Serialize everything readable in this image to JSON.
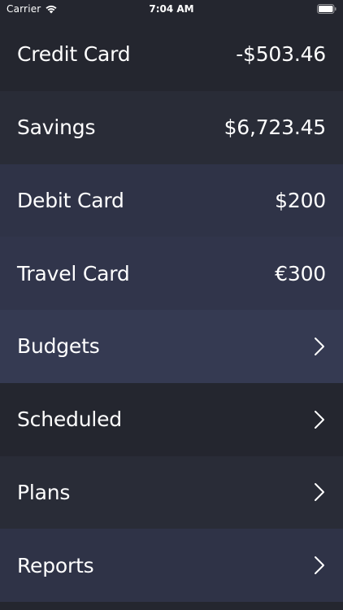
{
  "status_bar": {
    "carrier": "Carrier",
    "time": "7:04 AM",
    "wifi_icon": "wifi-icon",
    "battery_icon": "battery-icon"
  },
  "colors": {
    "row_dark_1": "#24262f",
    "row_dark_2": "#292c37",
    "row_blue_1": "#2f3347",
    "row_blue_2": "#31354b",
    "row_blue_3": "#353a52",
    "text": "#ffffff"
  },
  "accounts": [
    {
      "label": "Credit Card",
      "value": "-$503.46"
    },
    {
      "label": "Savings",
      "value": "$6,723.45"
    },
    {
      "label": "Debit Card",
      "value": "$200"
    },
    {
      "label": "Travel Card",
      "value": "€300"
    }
  ],
  "menu": [
    {
      "label": "Budgets",
      "icon": "chevron-right-icon"
    },
    {
      "label": "Scheduled",
      "icon": "chevron-right-icon"
    },
    {
      "label": "Plans",
      "icon": "chevron-right-icon"
    },
    {
      "label": "Reports",
      "icon": "chevron-right-icon"
    }
  ]
}
